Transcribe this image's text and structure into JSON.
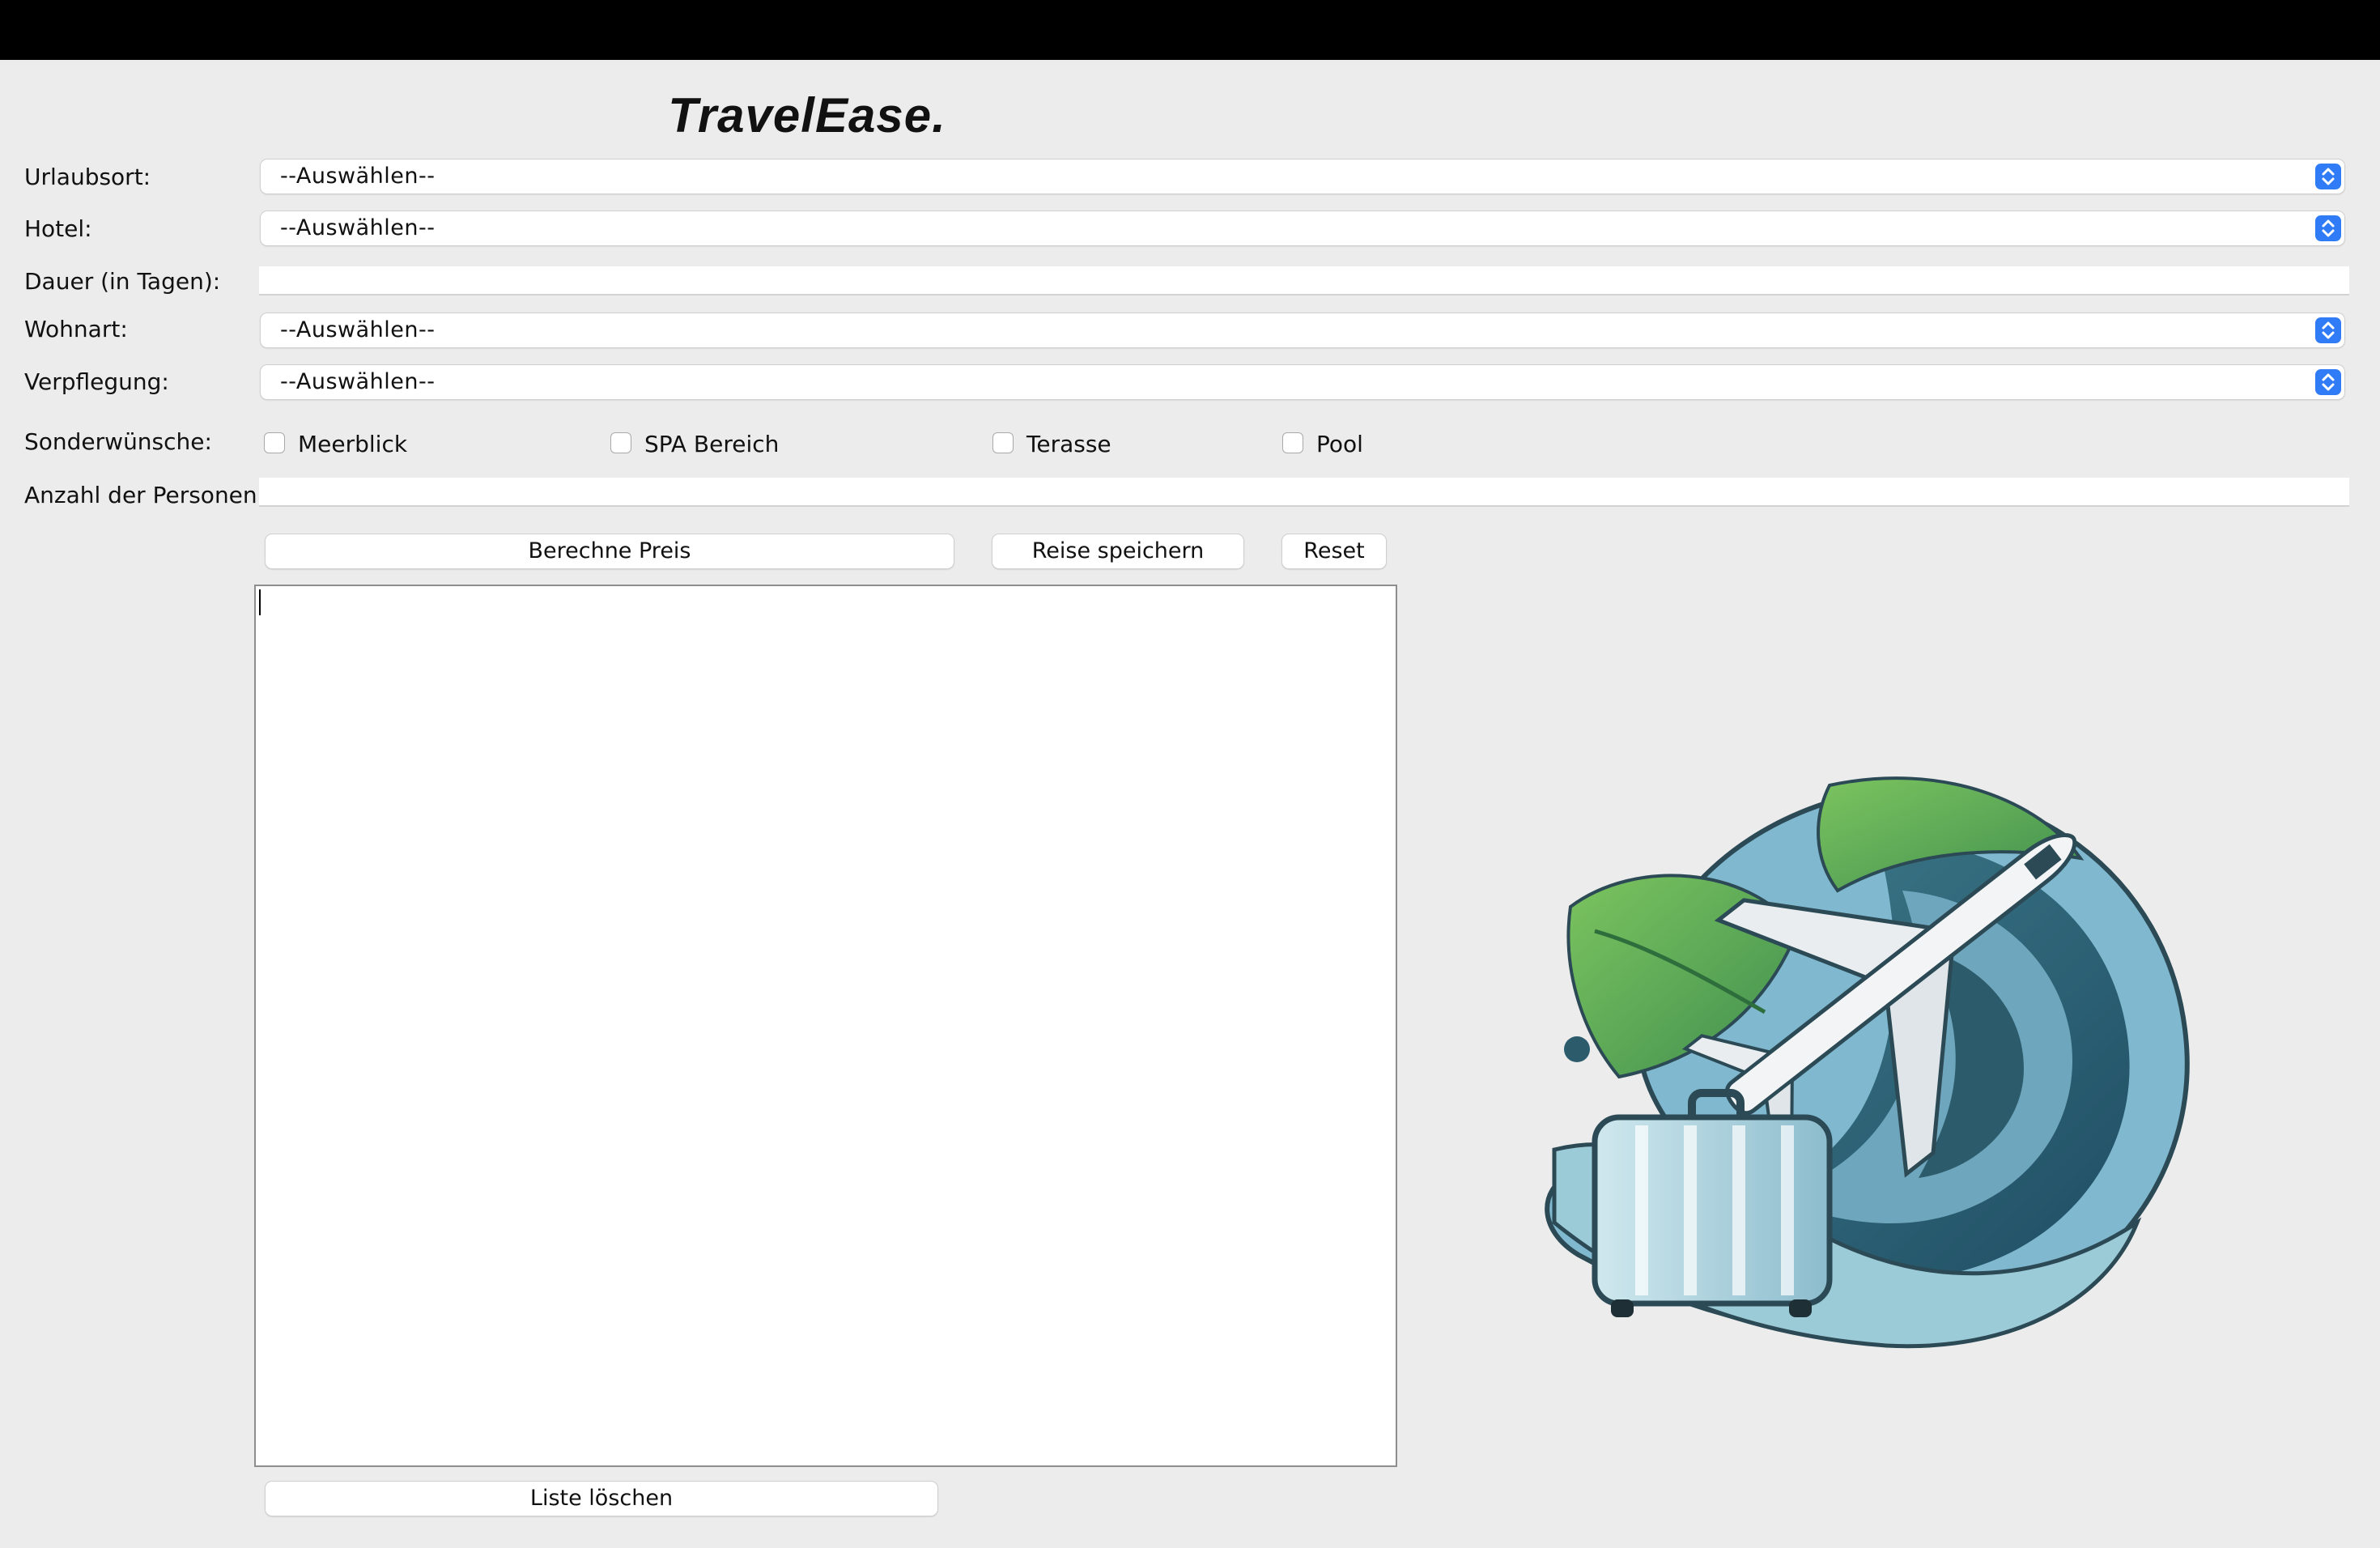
{
  "app": {
    "title": "TravelEase."
  },
  "form": {
    "labels": {
      "destination": "Urlaubsort:",
      "hotel": "Hotel:",
      "duration": "Dauer (in Tagen):",
      "accommodation": "Wohnart:",
      "meals": "Verpflegung:",
      "extras": "Sonderwünsche:",
      "persons": "Anzahl der Personen:"
    },
    "destination_value": "--Auswählen--",
    "hotel_value": "--Auswählen--",
    "duration_value": "",
    "accommodation_value": "--Auswählen--",
    "meals_value": "--Auswählen--",
    "persons_value": "",
    "extras": [
      {
        "label": "Meerblick",
        "checked": false
      },
      {
        "label": "SPA Bereich",
        "checked": false
      },
      {
        "label": "Terasse",
        "checked": false
      },
      {
        "label": "Pool",
        "checked": false
      }
    ]
  },
  "buttons": {
    "calculate": "Berechne Preis",
    "save": "Reise speichern",
    "reset": "Reset",
    "clear_list": "Liste löschen"
  },
  "output": {
    "text": ""
  },
  "logo": {
    "icon": "airplane-suitcase-logo",
    "colors": {
      "leaf": "#5fb04a",
      "wave_dark": "#2c5c6c",
      "wave_light": "#7fb8cf",
      "plane": "#f2f4f5",
      "suitcase": "#9fd0de"
    }
  },
  "colors": {
    "accent": "#2f7cf6",
    "background": "#ececec",
    "topbar": "#000000"
  }
}
